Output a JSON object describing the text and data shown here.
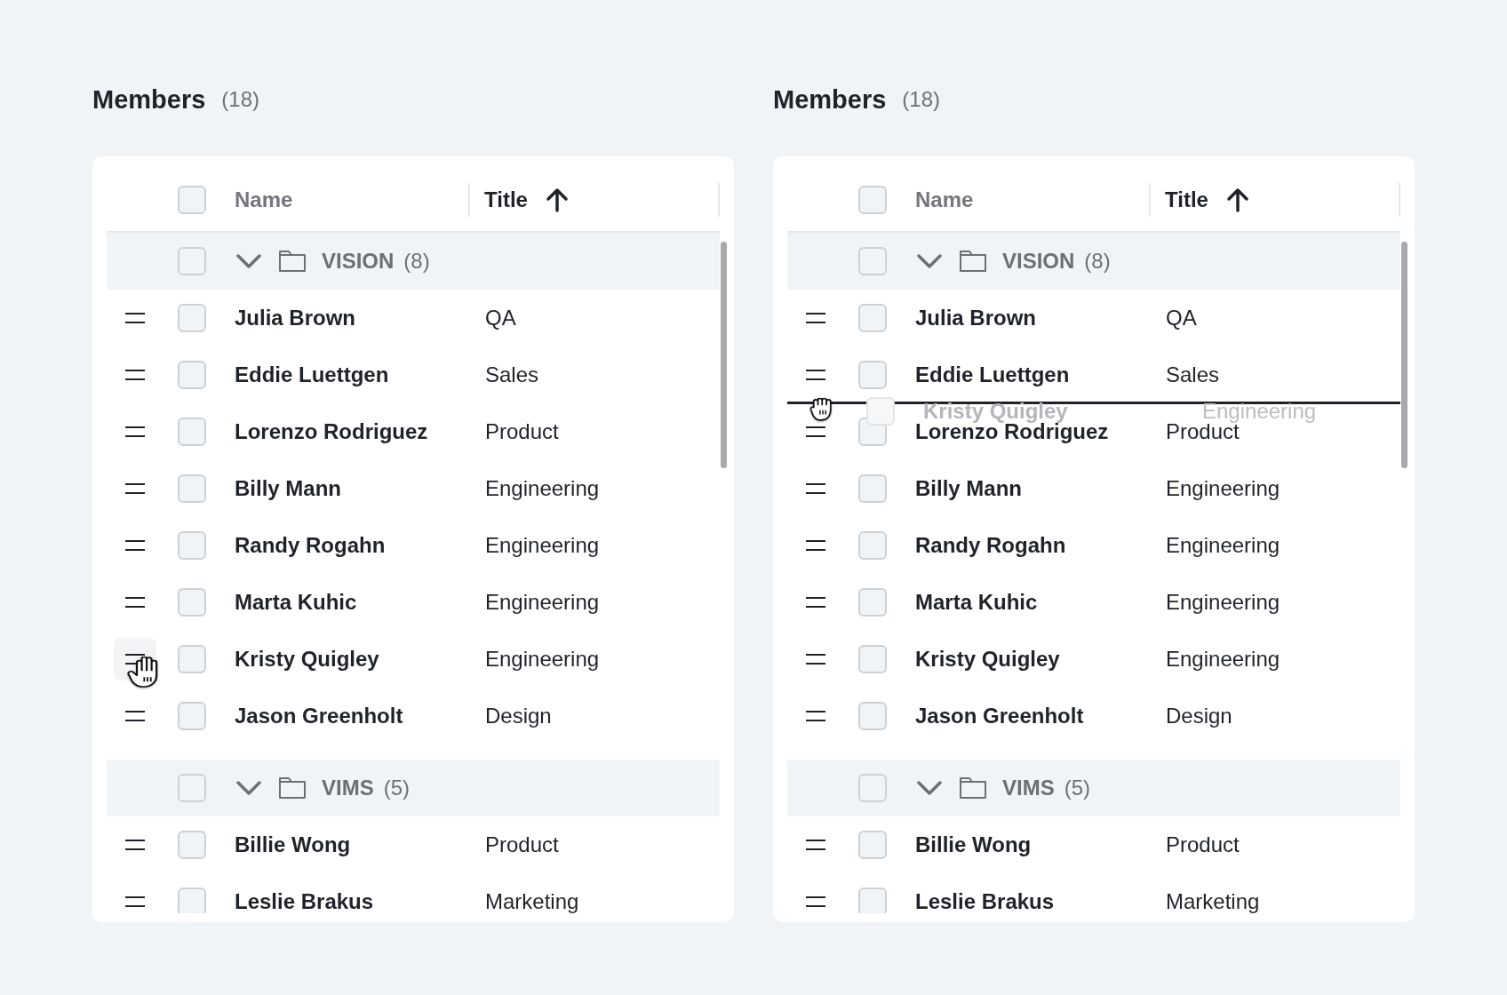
{
  "panels": [
    {
      "title": "Members",
      "count": "(18)",
      "select_all": {
        "checked": false
      },
      "columns": [
        {
          "label": "Name",
          "sorted": false
        },
        {
          "label": "Title",
          "sorted": true
        }
      ],
      "groups": [
        {
          "name": "VISION",
          "count": "(8)",
          "checked": false,
          "expanded": true,
          "rows": [
            {
              "kind": "member",
              "name": "Julia Brown",
              "title": "QA",
              "checked": false,
              "hovered": false
            },
            {
              "kind": "member",
              "name": "Eddie Luettgen",
              "title": "Sales",
              "checked": false,
              "hovered": false
            },
            {
              "kind": "member",
              "name": "Lorenzo Rodriguez",
              "title": "Product",
              "checked": false,
              "hovered": false
            },
            {
              "kind": "member",
              "name": "Billy Mann",
              "title": "Engineering",
              "checked": false,
              "hovered": false
            },
            {
              "kind": "member",
              "name": "Randy Rogahn",
              "title": "Engineering",
              "checked": false,
              "hovered": false
            },
            {
              "kind": "member",
              "name": "Marta Kuhic",
              "title": "Engineering",
              "checked": false,
              "hovered": false
            },
            {
              "kind": "member",
              "name": "Kristy Quigley",
              "title": "Engineering",
              "checked": false,
              "hovered": true
            },
            {
              "kind": "member",
              "name": "Jason Greenholt",
              "title": "Design",
              "checked": false,
              "hovered": false
            }
          ]
        },
        {
          "name": "VIMS",
          "count": "(5)",
          "checked": false,
          "expanded": true,
          "rows": [
            {
              "kind": "member",
              "name": "Billie Wong",
              "title": "Product",
              "checked": false,
              "hovered": false
            },
            {
              "kind": "member",
              "name": "Leslie Brakus",
              "title": "Marketing",
              "checked": false,
              "hovered": false
            }
          ]
        }
      ]
    },
    {
      "title": "Members",
      "count": "(18)",
      "select_all": {
        "checked": false
      },
      "columns": [
        {
          "label": "Name",
          "sorted": false
        },
        {
          "label": "Title",
          "sorted": true
        }
      ],
      "groups": [
        {
          "name": "VISION",
          "count": "(8)",
          "checked": false,
          "expanded": true,
          "rows": [
            {
              "kind": "member",
              "name": "Julia Brown",
              "title": "QA",
              "checked": false,
              "hovered": false
            },
            {
              "kind": "member",
              "name": "Eddie Luettgen",
              "title": "Sales",
              "checked": false,
              "hovered": false
            },
            {
              "kind": "drag-preview",
              "name": "Kristy Quigley",
              "title": "Engineering",
              "checked": false
            },
            {
              "kind": "member",
              "name": "Lorenzo Rodriguez",
              "title": "Product",
              "checked": false,
              "hovered": false
            },
            {
              "kind": "member",
              "name": "Billy Mann",
              "title": "Engineering",
              "checked": false,
              "hovered": false
            },
            {
              "kind": "member",
              "name": "Randy Rogahn",
              "title": "Engineering",
              "checked": false,
              "hovered": false
            },
            {
              "kind": "member",
              "name": "Marta Kuhic",
              "title": "Engineering",
              "checked": false,
              "hovered": false
            },
            {
              "kind": "member",
              "name": "Kristy Quigley",
              "title": "Engineering",
              "checked": false,
              "hovered": false
            },
            {
              "kind": "member",
              "name": "Jason Greenholt",
              "title": "Design",
              "checked": false,
              "hovered": false
            }
          ]
        },
        {
          "name": "VIMS",
          "count": "(5)",
          "checked": false,
          "expanded": true,
          "rows": [
            {
              "kind": "member",
              "name": "Billie Wong",
              "title": "Product",
              "checked": false,
              "hovered": false
            },
            {
              "kind": "member",
              "name": "Leslie Brakus",
              "title": "Marketing",
              "checked": false,
              "hovered": false
            }
          ]
        }
      ]
    }
  ]
}
